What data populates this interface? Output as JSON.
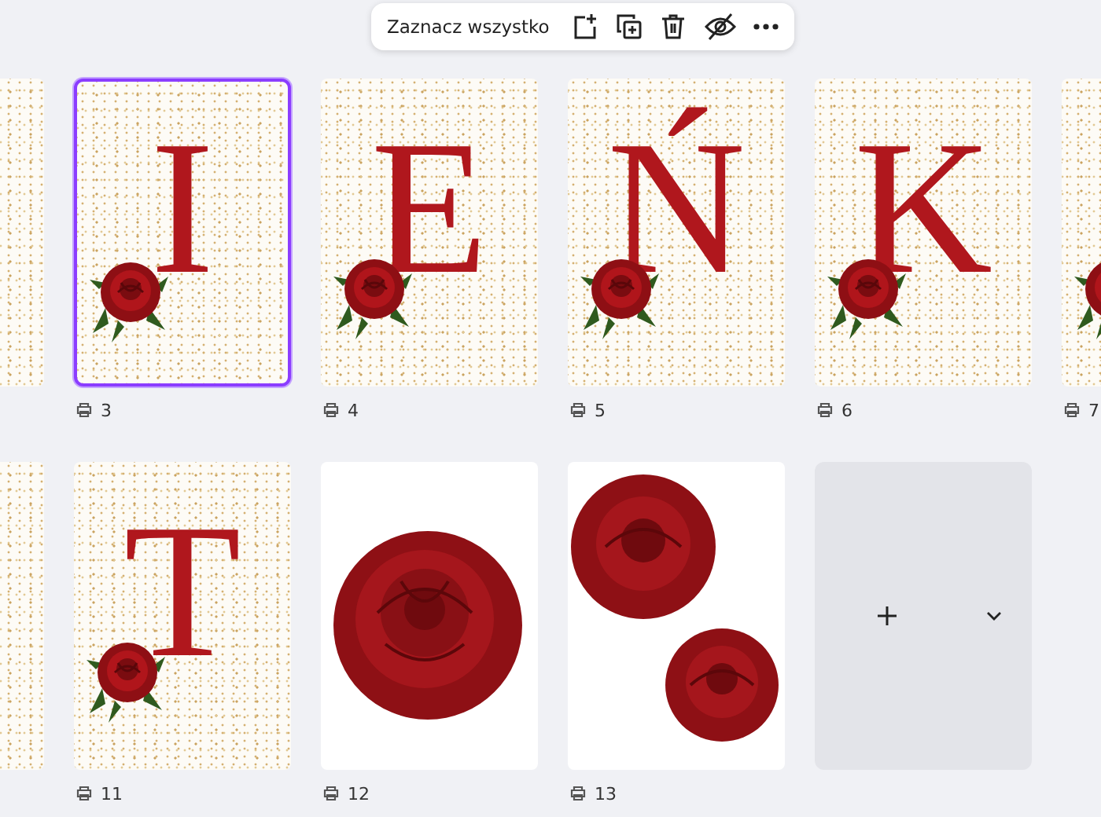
{
  "toolbar": {
    "select_all": "Zaznacz wszystko"
  },
  "rows": [
    {
      "pages": [
        {
          "kind": "speckled",
          "selected": false
        },
        {
          "kind": "letter",
          "letter": "I",
          "label": "3",
          "selected": true
        },
        {
          "kind": "letter",
          "letter": "E",
          "label": "4",
          "selected": false
        },
        {
          "kind": "letter",
          "letter": "Ń",
          "label": "5",
          "selected": false
        },
        {
          "kind": "letter",
          "letter": "K",
          "label": "6",
          "selected": false
        },
        {
          "kind": "letter",
          "label": "7",
          "selected": false
        }
      ]
    },
    {
      "pages": [
        {
          "kind": "speckled",
          "selected": false
        },
        {
          "kind": "letter",
          "letter": "T",
          "label": "11",
          "selected": false
        },
        {
          "kind": "rose",
          "label": "12",
          "selected": false
        },
        {
          "kind": "roses",
          "label": "13",
          "selected": false
        },
        {
          "kind": "add"
        }
      ]
    }
  ]
}
